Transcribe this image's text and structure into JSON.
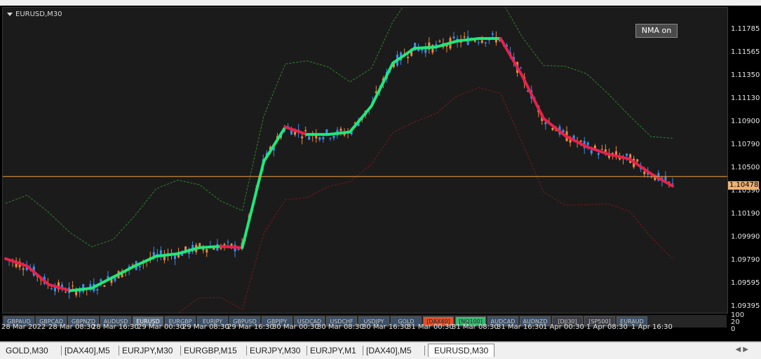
{
  "window": {
    "title": "EURUSD,M30",
    "nma_button": "NMA on",
    "current_price": "1.10478"
  },
  "price_axis": [
    "1.11785",
    "1.11565",
    "1.11350",
    "1.11130",
    "1.10900",
    "1.10790",
    "1.10500",
    "1.10390",
    "1.10190",
    "1.09990",
    "1.09790",
    "1.09595",
    "1.09395"
  ],
  "subwindow_axis": [
    "100",
    "20",
    "0"
  ],
  "symbol_buttons": [
    {
      "label": "GBPAUD",
      "style": "normal"
    },
    {
      "label": "GBPCAD",
      "style": "normal"
    },
    {
      "label": "GBPNZD",
      "style": "normal"
    },
    {
      "label": "AUDUSD",
      "style": "normal"
    },
    {
      "label": "EURUSD",
      "style": "active"
    },
    {
      "label": "EURGBP",
      "style": "normal"
    },
    {
      "label": "EURJPY",
      "style": "normal"
    },
    {
      "label": "GBPUSD",
      "style": "normal"
    },
    {
      "label": "GBPJPY",
      "style": "normal"
    },
    {
      "label": "USDCAD",
      "style": "normal"
    },
    {
      "label": "USDCHF",
      "style": "normal"
    },
    {
      "label": "USDJPY",
      "style": "normal"
    },
    {
      "label": "GOLD",
      "style": "normal"
    },
    {
      "label": "[DAX40]",
      "style": "hot"
    },
    {
      "label": "[NQ100]",
      "style": "green"
    },
    {
      "label": "AUDCAD",
      "style": "normal"
    },
    {
      "label": "AUDNZD",
      "style": "normal"
    },
    {
      "label": "[DJI30]",
      "style": "dark"
    },
    {
      "label": "[SP500]",
      "style": "dark"
    },
    {
      "label": "EURAUD",
      "style": "normal"
    }
  ],
  "time_axis": [
    "28 Mar 2022",
    "28 Mar 08:30",
    "28 Mar 16:30",
    "29 Mar 00:30",
    "29 Mar 08:30",
    "29 Mar 16:30",
    "30 Mar 00:30",
    "30 Mar 08:30",
    "30 Mar 16:30",
    "31 Mar 00:30",
    "31 Mar 08:30",
    "31 Mar 16:30",
    "1 Apr 00:30",
    "1 Apr 08:30",
    "1 Apr 16:30"
  ],
  "chart_tabs": [
    {
      "label": "GOLD,M30",
      "active": false
    },
    {
      "label": "[DAX40],M5",
      "active": false
    },
    {
      "label": "EURJPY,M30",
      "active": false
    },
    {
      "label": "EURGBP,M15",
      "active": false
    },
    {
      "label": "EURJPY,M30",
      "active": false
    },
    {
      "label": "EURJPY,M1",
      "active": false
    },
    {
      "label": "[DAX40],M5",
      "active": false
    },
    {
      "label": "EURUSD,M30",
      "active": true
    }
  ],
  "colors": {
    "bull_candle": "#3c8ee8",
    "bear_candle": "#e88a40",
    "nma_up": "#1fe87a",
    "nma_down": "#e8204c",
    "band_upper": "#2a8a2a",
    "band_lower": "#7a1a1a",
    "price_line": "#f0a040"
  },
  "chart_data": {
    "type": "line",
    "series": [
      {
        "values": [
          1.0981,
          1.0975,
          1.096,
          1.0955,
          1.0957,
          1.0966,
          1.0975,
          1.0983,
          1.0985,
          1.099,
          1.0991,
          1.099,
          1.106,
          1.1088,
          1.1082,
          1.1082,
          1.1084,
          1.1105,
          1.114,
          1.1152,
          1.1153,
          1.1158,
          1.116,
          1.116,
          1.113,
          1.1095,
          1.1081,
          1.1072,
          1.1066,
          1.1062,
          1.105,
          1.104
        ]
      }
    ]
  }
}
